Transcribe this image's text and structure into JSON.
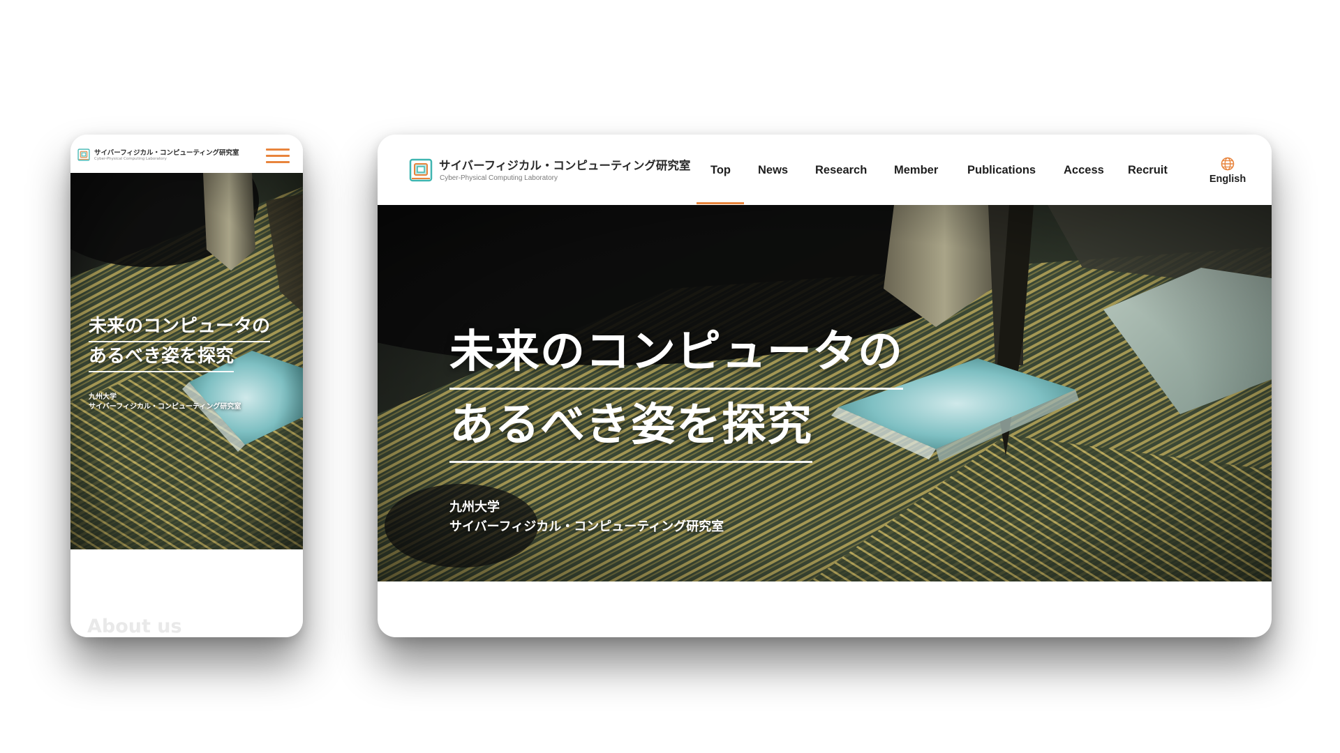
{
  "site": {
    "title_ja": "サイバーフィジカル・コンピューティング研究室",
    "title_en": "Cyber-Physical Computing Laboratory"
  },
  "nav": {
    "items": [
      {
        "label": "Top",
        "active": true
      },
      {
        "label": "News",
        "active": false
      },
      {
        "label": "Research",
        "active": false
      },
      {
        "label": "Member",
        "active": false
      },
      {
        "label": "Publications",
        "active": false
      },
      {
        "label": "Access",
        "active": false
      },
      {
        "label": "Recruit",
        "active": false
      }
    ],
    "language": {
      "label": "English",
      "icon": "globe-icon"
    },
    "menu_icon": "hamburger-menu-icon"
  },
  "hero": {
    "headline_line1": "未来のコンピュータの",
    "headline_line2": "あるべき姿を探究",
    "university": "九州大学",
    "lab_name": "サイバーフィジカル・コンピューティング研究室",
    "image": "chip-probe-photo"
  },
  "mobile": {
    "section_heading": "About us"
  },
  "colors": {
    "accent": "#e8843c",
    "logo_teal": "#3fb5b0",
    "text": "#1e1e1e"
  }
}
